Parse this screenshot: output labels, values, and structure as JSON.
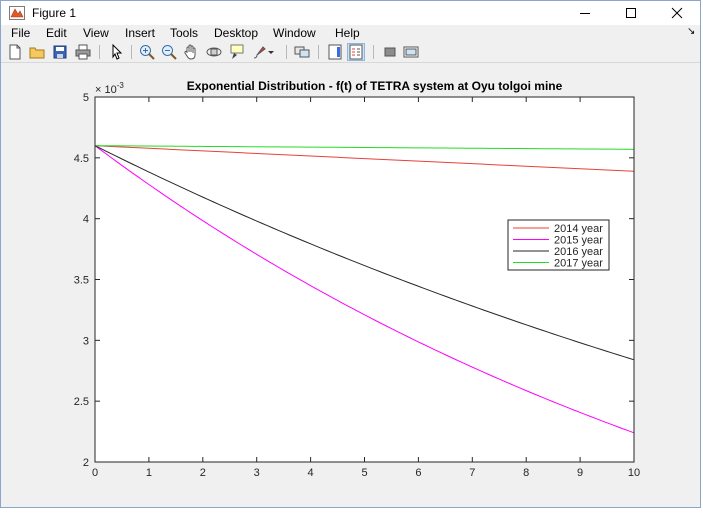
{
  "window": {
    "title": "Figure 1",
    "icon": "matlab-figure-icon",
    "controls": [
      "minimize-icon",
      "maximize-icon",
      "close-icon"
    ]
  },
  "menu": [
    "File",
    "Edit",
    "View",
    "Insert",
    "Tools",
    "Desktop",
    "Window",
    "Help"
  ],
  "menu_overflow_glyph": "↘",
  "toolbar": [
    "new-figure-icon",
    "open-file-icon",
    "save-icon",
    "print-icon",
    "edit-plot-arrow-icon",
    "zoom-in-icon",
    "zoom-out-icon",
    "pan-hand-icon",
    "rotate-3d-icon",
    "data-cursor-icon",
    "brush-icon",
    "brush-dropdown-icon",
    "link-plot-icon",
    "insert-colorbar-icon",
    "insert-legend-icon",
    "hide-plot-tools-icon",
    "show-plot-tools-icon"
  ],
  "chart_data": {
    "type": "line",
    "title": "Exponential Distribution - f(t) of TETRA system at Oyu tolgoi mine",
    "xlabel": "",
    "ylabel": "",
    "xlim": [
      0,
      10
    ],
    "ylim": [
      0.002,
      0.005
    ],
    "y_exponent_label": "× 10",
    "y_exponent_value": "-3",
    "x_ticks": [
      "0",
      "1",
      "2",
      "3",
      "4",
      "5",
      "6",
      "7",
      "8",
      "9",
      "10"
    ],
    "y_ticks": [
      "2",
      "2.5",
      "3",
      "3.5",
      "4",
      "4.5",
      "5"
    ],
    "grid": false,
    "legend_position": "right",
    "series": [
      {
        "name": "2014 year",
        "color": "#e8413b",
        "x": [
          0,
          10
        ],
        "y": [
          0.0046,
          0.00439
        ]
      },
      {
        "name": "2015 year",
        "color": "#ff00ff",
        "x": [
          0,
          10
        ],
        "y": [
          0.0046,
          0.00224
        ]
      },
      {
        "name": "2016 year",
        "color": "#262626",
        "x": [
          0,
          10
        ],
        "y": [
          0.0046,
          0.00284
        ]
      },
      {
        "name": "2017 year",
        "color": "#22dd22",
        "x": [
          0,
          10
        ],
        "y": [
          0.0046,
          0.00457
        ]
      }
    ]
  }
}
